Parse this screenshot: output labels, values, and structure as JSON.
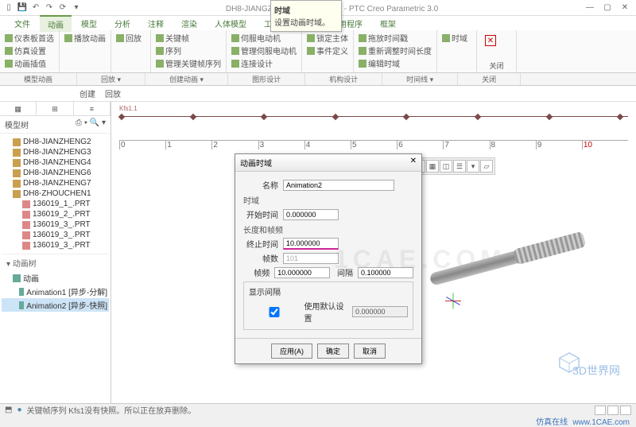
{
  "title": "DH8-JIANGZHENG1_（活动的）- PTC Creo Parametric 3.0",
  "menu": {
    "file": "文件",
    "anim": "动画",
    "model": "模型",
    "analysis": "分析",
    "annot": "注释",
    "render": "渲染",
    "manikin": "人体模型",
    "tools": "工具",
    "view": "视图",
    "app": "应用程序",
    "frame": "框架"
  },
  "ribbon": {
    "g1": {
      "i1": "仪表板首选",
      "i2": "仿真设置",
      "i3": "动画插值"
    },
    "g2": {
      "i1": "播放动画"
    },
    "g3": {
      "i1": "回放"
    },
    "g4": {
      "i1": "关键帧",
      "i2": "序列",
      "i3": "管理关键帧序列"
    },
    "g5": {
      "i1": "伺服电动机",
      "i2": "管理伺服电动机",
      "i3": "连接设计"
    },
    "g6": {
      "i1": "锁定主体",
      "i2": "事件定义",
      "i3": ""
    },
    "g7": {
      "i1": "拖放时间戳",
      "i2": "重新调整时间长度",
      "i3": "编辑时域"
    },
    "g8": {
      "i1": "时域"
    },
    "close": "关闭"
  },
  "subribbon": {
    "g1": "模型动画",
    "g2": "回放 ▾",
    "g3": "创建动画 ▾",
    "g4": "图形设计",
    "g5": "机构设计",
    "g6": "时间线 ▾",
    "g7": "关闭"
  },
  "toolbar2": {
    "b1": "创建",
    "b2": "回放"
  },
  "tooltip": {
    "t1": "时域",
    "t2": "设置动画时域。"
  },
  "side": {
    "tabs": {
      "a": "▦",
      "b": "⊞",
      "c": "≡"
    },
    "hdr": "模型树",
    "icons": "⎙ ▾ 🔍 ▾",
    "nodes": [
      {
        "t": "DH8-JIANZHENG2",
        "c": "asm"
      },
      {
        "t": "DH8-JIANZHENG3",
        "c": "asm"
      },
      {
        "t": "DH8-JIANZHENG4",
        "c": "asm"
      },
      {
        "t": "DH8-JIANZHENG6",
        "c": "asm"
      },
      {
        "t": "DH8-JIANZHENG7",
        "c": "asm"
      },
      {
        "t": "DH8-ZHOUCHEN1",
        "c": "asm"
      },
      {
        "t": "136019_1_.PRT",
        "c": "prt"
      },
      {
        "t": "136019_2_.PRT",
        "c": "prt"
      },
      {
        "t": "136019_3_.PRT",
        "c": "prt"
      },
      {
        "t": "136019_3_.PRT",
        "c": "prt"
      },
      {
        "t": "136019_3_.PRT",
        "c": "prt"
      }
    ],
    "animsect": "▾ 动画树",
    "animroot": "动画",
    "a1": "Animation1 [异步-分解]",
    "a2": "Animation2 [异步-快照]"
  },
  "timeline": {
    "label": "Kfs1.1"
  },
  "ruler": {
    "ticks": [
      "0",
      "1",
      "2",
      "3",
      "4",
      "5",
      "6",
      "7",
      "8",
      "9"
    ],
    "end": "10"
  },
  "dialog": {
    "title": "动画时域",
    "name_lbl": "名称",
    "name": "Animation2",
    "grp1": "时域",
    "start_lbl": "开始时间",
    "start": "0.000000",
    "grp2": "长度和帧频",
    "end_lbl": "终止时间",
    "end": "10.000000",
    "frames_lbl": "帧数",
    "frames": "101",
    "rate_lbl": "帧频",
    "rate": "10.000000",
    "interval_lbl": "间隔",
    "interval": "0.100000",
    "grp3": "显示间隔",
    "chk": "使用默认设置",
    "chkval": "0.000000",
    "apply": "应用(A)",
    "ok": "确定",
    "cancel": "取消"
  },
  "status": {
    "msg": "关键帧序列 Kfs1没有快照。所以正在放弃删除。"
  },
  "watermarks": {
    "big": "1CAE.COM",
    "url": "www.1CAE.com",
    "brand": "仿真在线",
    "cube": "3D世界网"
  }
}
